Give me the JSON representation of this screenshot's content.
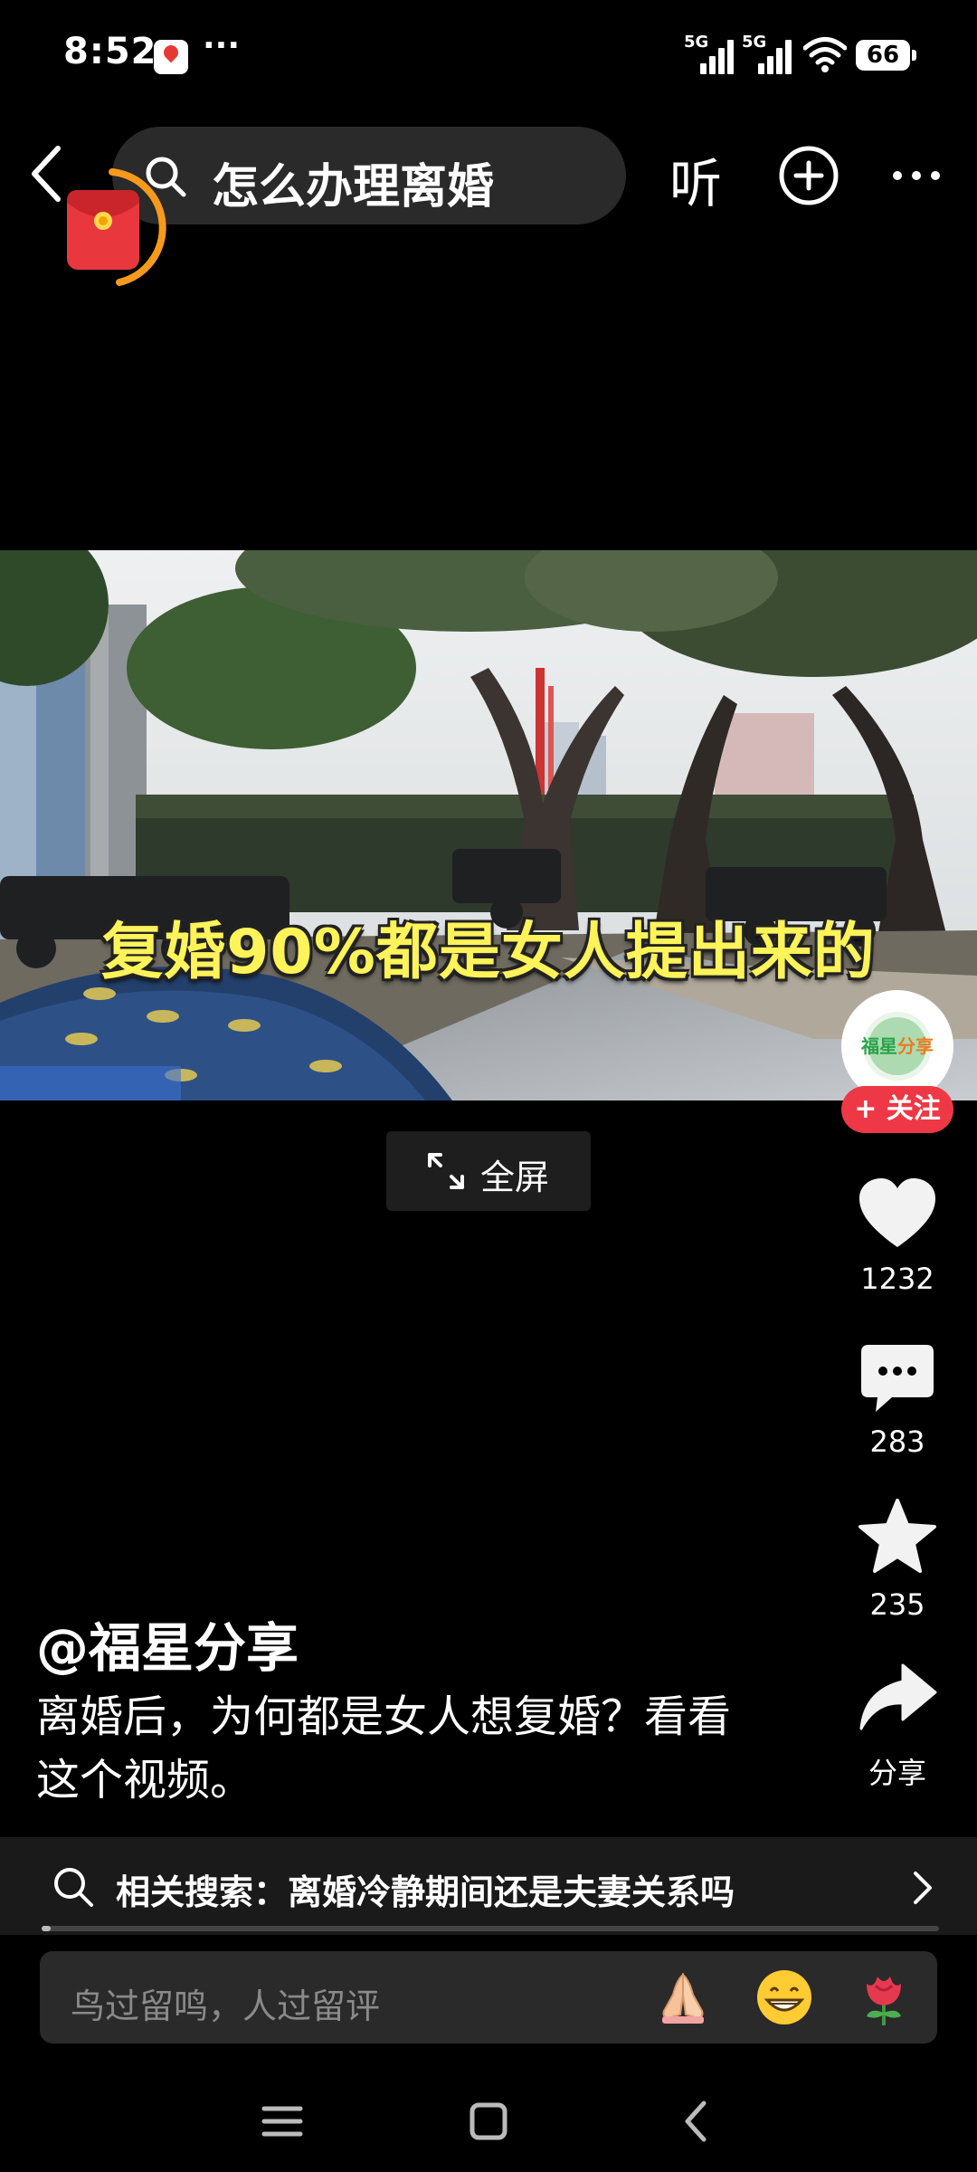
{
  "status_bar": {
    "time": "8:52",
    "overflow": "···",
    "network_1": "5G",
    "network_2": "5G",
    "battery": "66",
    "icons": [
      "location-pin-icon",
      "signal-icon",
      "signal-icon",
      "wifi-icon",
      "battery-icon"
    ]
  },
  "top_nav": {
    "search_query": "怎么办理离婚",
    "listen_label": "听",
    "icons": [
      "back-arrow-icon",
      "search-icon",
      "plus-circle-icon",
      "more-icon",
      "red-envelope-icon"
    ]
  },
  "video": {
    "subtitle": "复婚90%都是女人提出来的",
    "fullscreen_label": "全屏",
    "progress": 0.01
  },
  "rail": {
    "avatar_text_1": "福星",
    "avatar_text_2": "分享",
    "follow_label": "+ 关注",
    "likes": "1232",
    "comments": "283",
    "favorites": "235",
    "share_label": "分享",
    "icons": [
      "heart-icon",
      "comment-icon",
      "star-icon",
      "share-icon"
    ]
  },
  "caption": {
    "author": "@福星分享",
    "description": "离婚后，为何都是女人想复婚？看看这个视频。"
  },
  "related_search": {
    "text": "相关搜索：离婚冷静期间还是夫妻关系吗"
  },
  "comment_bar": {
    "placeholder": "鸟过留鸣，人过留评",
    "emojis": [
      "folded-hands-emoji",
      "grinning-emoji",
      "rose-emoji"
    ]
  },
  "colors": {
    "background": "#000000",
    "accent_red": "#ee3846",
    "subtitle_yellow": "#fff35a",
    "ring_orange": "#f59a1b"
  }
}
